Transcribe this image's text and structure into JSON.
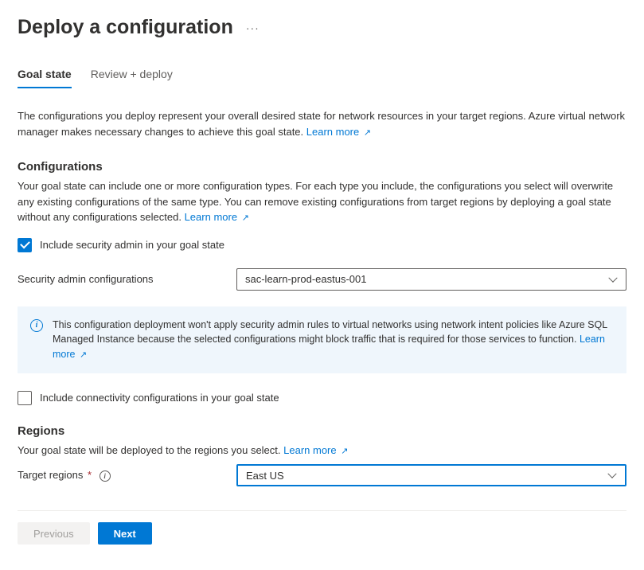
{
  "header": {
    "title": "Deploy a configuration"
  },
  "tabs": {
    "goal_state": "Goal state",
    "review_deploy": "Review + deploy"
  },
  "intro": {
    "text": "The configurations you deploy represent your overall desired state for network resources in your target regions. Azure virtual network manager makes necessary changes to achieve this goal state. ",
    "link": "Learn more"
  },
  "configurations": {
    "heading": "Configurations",
    "desc": "Your goal state can include one or more configuration types. For each type you include, the configurations you select will overwrite any existing configurations of the same type. You can remove existing configurations from target regions by deploying a goal state without any configurations selected. ",
    "link": "Learn more",
    "include_security_label": "Include security admin in your goal state",
    "security_label": "Security admin configurations",
    "security_value": "sac-learn-prod-eastus-001",
    "info_text": "This configuration deployment won't apply security admin rules to virtual networks using network intent policies like Azure SQL Managed Instance because the selected configurations might block traffic that is required for those services to function.  ",
    "info_link": "Learn more",
    "include_connectivity_label": "Include connectivity configurations in your goal state"
  },
  "regions": {
    "heading": "Regions",
    "desc": "Your goal state will be deployed to the regions you select. ",
    "link": "Learn more",
    "target_label": "Target regions",
    "target_value": "East US"
  },
  "footer": {
    "previous": "Previous",
    "next": "Next"
  }
}
